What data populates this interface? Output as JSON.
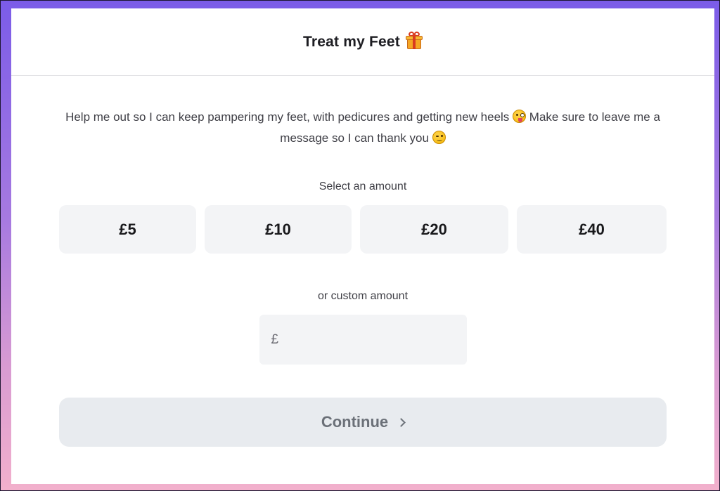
{
  "header": {
    "title": "Treat my Feet",
    "title_icon": "gift-icon"
  },
  "description": {
    "part1": "Help me out so I can keep pampering my feet, with pedicures and getting new heels",
    "emoji1": "face-with-tongue-wink-icon",
    "part2": "Make sure to leave me a message so I can thank you",
    "emoji2": "winking-face-icon"
  },
  "amounts": {
    "label": "Select an amount",
    "options": [
      "£5",
      "£10",
      "£20",
      "£40"
    ]
  },
  "custom": {
    "label": "or custom amount",
    "currency_symbol": "£",
    "value": "",
    "placeholder": ""
  },
  "continue": {
    "label": "Continue",
    "icon": "chevron-right-icon"
  },
  "colors": {
    "frame_top": "#7b5ce8",
    "frame_bottom": "#f2b0cc",
    "button_bg": "#f3f4f6",
    "continue_bg": "#e8ebef",
    "continue_text": "#6b7078"
  }
}
